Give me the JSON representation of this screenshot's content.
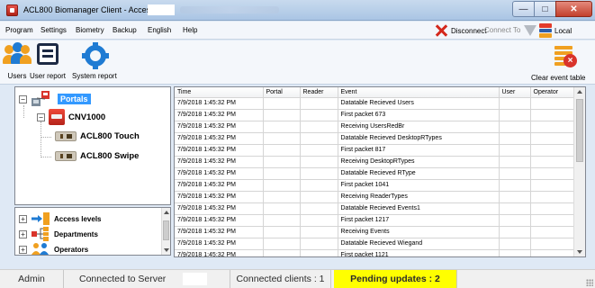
{
  "window": {
    "title": "ACL800 Biomanager Client - Access -",
    "controls": {
      "minimize": "—",
      "maximize": "□",
      "close": "✕"
    }
  },
  "menu": {
    "items": [
      "Program",
      "Settings",
      "Biometry",
      "Backup",
      "English",
      "Help"
    ],
    "disconnect_label": "Disconnect",
    "connect_to_label": "Connect To",
    "local_label": "Local"
  },
  "toolbar": {
    "users_label": "Users",
    "user_report_label": "User report",
    "system_report_label": "System report",
    "clear_event_table_label": "Clear event table"
  },
  "tree": {
    "root": {
      "label": "Portals",
      "expander": "−"
    },
    "controller": {
      "label": "CNV1000",
      "expander": "−"
    },
    "readers": [
      {
        "label": "ACL800 Touch"
      },
      {
        "label": "ACL800 Swipe"
      }
    ]
  },
  "categories": [
    {
      "label": "Access levels",
      "expander": "+"
    },
    {
      "label": "Departments",
      "expander": "+"
    },
    {
      "label": "Operators",
      "expander": "+"
    }
  ],
  "events": {
    "columns": [
      "Time",
      "Portal",
      "Reader",
      "Event",
      "User",
      "Operator"
    ],
    "rows": [
      {
        "time": "7/9/2018 1:45:32 PM",
        "portal": "",
        "reader": "",
        "event": "Datatable Recieved Users",
        "user": "",
        "operator": ""
      },
      {
        "time": "7/9/2018 1:45:32 PM",
        "portal": "",
        "reader": "",
        "event": "First packet 673",
        "user": "",
        "operator": ""
      },
      {
        "time": "7/9/2018 1:45:32 PM",
        "portal": "",
        "reader": "",
        "event": "Receiving UsersRedBr",
        "user": "",
        "operator": ""
      },
      {
        "time": "7/9/2018 1:45:32 PM",
        "portal": "",
        "reader": "",
        "event": "Datatable Recieved DesktopRTypes",
        "user": "",
        "operator": ""
      },
      {
        "time": "7/9/2018 1:45:32 PM",
        "portal": "",
        "reader": "",
        "event": "First packet 817",
        "user": "",
        "operator": ""
      },
      {
        "time": "7/9/2018 1:45:32 PM",
        "portal": "",
        "reader": "",
        "event": "Receiving DesktopRTypes",
        "user": "",
        "operator": ""
      },
      {
        "time": "7/9/2018 1:45:32 PM",
        "portal": "",
        "reader": "",
        "event": "Datatable Recieved RType",
        "user": "",
        "operator": ""
      },
      {
        "time": "7/9/2018 1:45:32 PM",
        "portal": "",
        "reader": "",
        "event": "First packet 1041",
        "user": "",
        "operator": ""
      },
      {
        "time": "7/9/2018 1:45:32 PM",
        "portal": "",
        "reader": "",
        "event": "Receiving ReaderTypes",
        "user": "",
        "operator": ""
      },
      {
        "time": "7/9/2018 1:45:32 PM",
        "portal": "",
        "reader": "",
        "event": "Datatable Recieved Events1",
        "user": "",
        "operator": ""
      },
      {
        "time": "7/9/2018 1:45:32 PM",
        "portal": "",
        "reader": "",
        "event": "First packet 1217",
        "user": "",
        "operator": ""
      },
      {
        "time": "7/9/2018 1:45:32 PM",
        "portal": "",
        "reader": "",
        "event": "Receiving Events",
        "user": "",
        "operator": ""
      },
      {
        "time": "7/9/2018 1:45:32 PM",
        "portal": "",
        "reader": "",
        "event": "Datatable Recieved Wiegand",
        "user": "",
        "operator": ""
      },
      {
        "time": "7/9/2018 1:45:32 PM",
        "portal": "",
        "reader": "",
        "event": "First packet 1121",
        "user": "",
        "operator": ""
      }
    ]
  },
  "status": {
    "user": "Admin",
    "connection": "Connected to Server",
    "clients": "Connected clients : 1",
    "pending": "Pending updates : 2"
  },
  "colors": {
    "pending_bg": "#ffff00",
    "selection": "#3399ff",
    "accent_blue": "#1f7bd3",
    "alert_red": "#d9342b"
  },
  "icons": [
    "app-icon",
    "disconnect-x-icon",
    "funnel-icon",
    "server-icon",
    "users-icon",
    "document-icon",
    "gear-icon",
    "clear-table-icon",
    "portals-icon",
    "controller-icon",
    "reader-icon",
    "access-levels-icon",
    "departments-icon",
    "operators-icon"
  ]
}
